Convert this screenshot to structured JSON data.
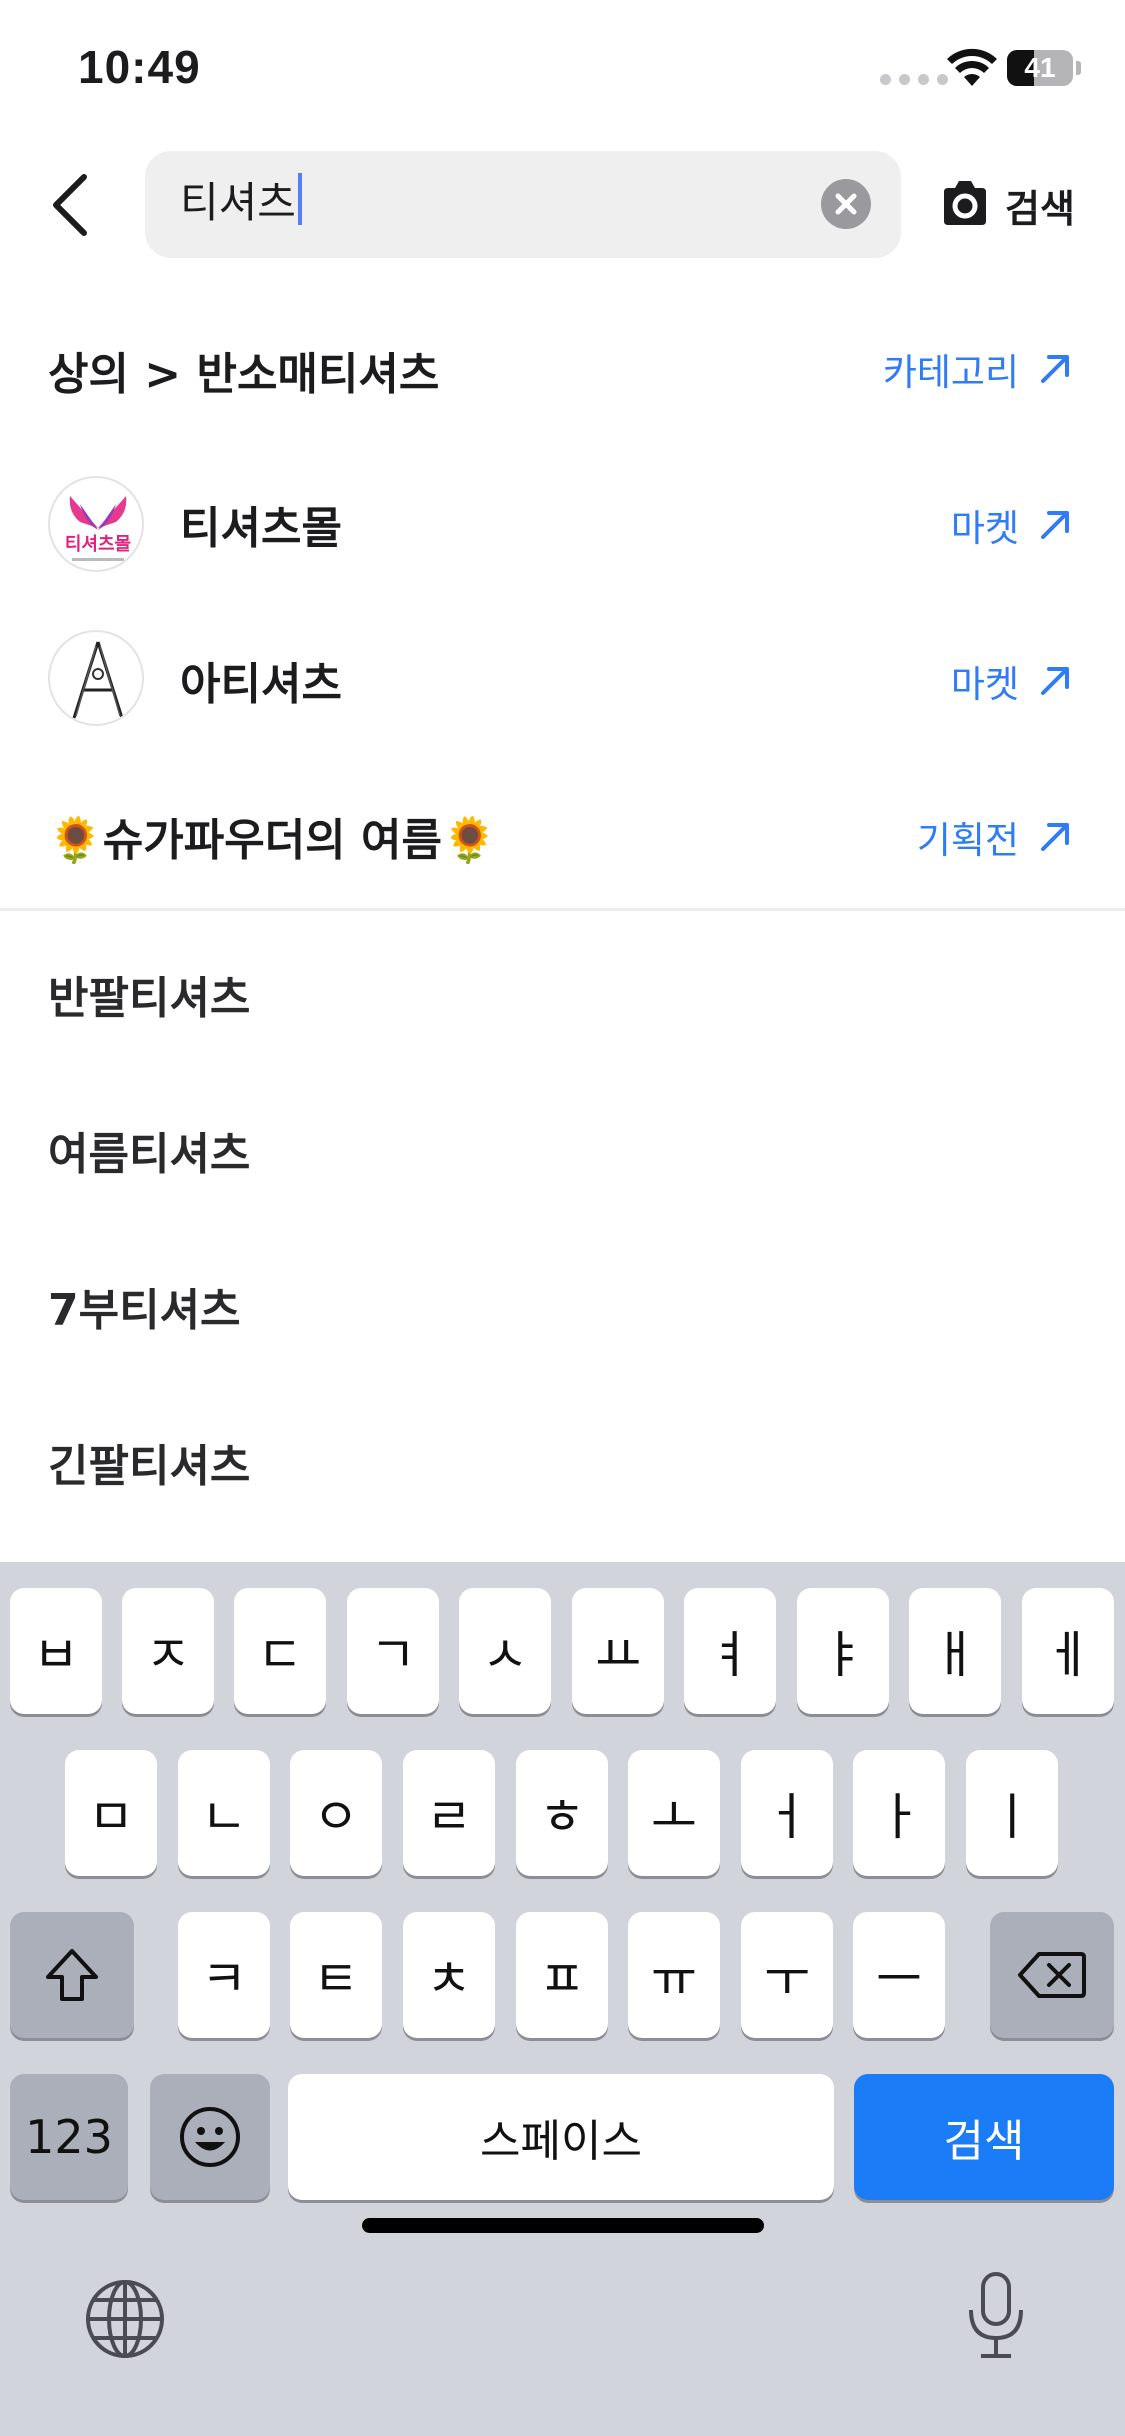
{
  "status_bar": {
    "time": "10:49",
    "battery": "41",
    "battery_level": 0.41
  },
  "search": {
    "query": "티셔츠",
    "submit_label": "검색"
  },
  "suggestions": [
    {
      "title": "상의 > 반소매티셔츠",
      "tag": "카테고리"
    },
    {
      "title": "티셔츠몰",
      "tag": "마켓",
      "avatar_label": "티셔츠몰"
    },
    {
      "title": "아티셔츠",
      "tag": "마켓",
      "avatar_label": "A"
    },
    {
      "title": "🌻슈가파우더의 여름🌻",
      "tag": "기획전"
    }
  ],
  "related": [
    "반팔티셔츠",
    "여름티셔츠",
    "7부티셔츠",
    "긴팔티셔츠"
  ],
  "keyboard": {
    "row1": [
      "ㅂ",
      "ㅈ",
      "ㄷ",
      "ㄱ",
      "ㅅ",
      "ㅛ",
      "ㅕ",
      "ㅑ",
      "ㅐ",
      "ㅔ"
    ],
    "row2": [
      "ㅁ",
      "ㄴ",
      "ㅇ",
      "ㄹ",
      "ㅎ",
      "ㅗ",
      "ㅓ",
      "ㅏ",
      "ㅣ"
    ],
    "row3": [
      "ㅋ",
      "ㅌ",
      "ㅊ",
      "ㅍ",
      "ㅠ",
      "ㅜ",
      "ㅡ"
    ],
    "numbers_label": "123",
    "space_label": "스페이스",
    "return_label": "검색"
  },
  "colors": {
    "accent": "#2f7cf6",
    "keyboard_bg": "#d1d4db",
    "return_key": "#1a7cf7"
  },
  "icons": [
    "back-chevron-icon",
    "clear-icon",
    "camera-icon",
    "arrow-up-right-icon",
    "shift-icon",
    "delete-icon",
    "emoji-icon",
    "globe-icon",
    "microphone-icon"
  ]
}
